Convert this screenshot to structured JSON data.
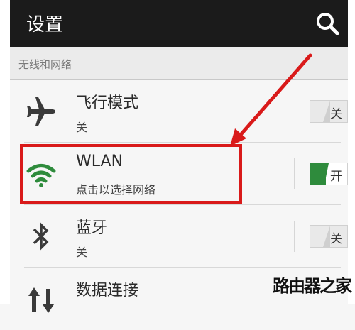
{
  "header": {
    "title": "设置",
    "search_icon": "search-icon"
  },
  "section": {
    "label": "无线和网络"
  },
  "rows": [
    {
      "title": "飞行模式",
      "subtitle": "关",
      "icon": "airplane-icon",
      "toggle": {
        "text": "关",
        "state": "off"
      }
    },
    {
      "title": "WLAN",
      "subtitle": "点击以选择网络",
      "icon": "wifi-icon",
      "toggle": {
        "text": "开",
        "state": "on"
      }
    },
    {
      "title": "蓝牙",
      "subtitle": "关",
      "icon": "bluetooth-icon",
      "toggle": {
        "text": "关",
        "state": "off"
      }
    },
    {
      "title": "数据连接",
      "icon": "data-transfer-icon"
    }
  ],
  "colors": {
    "action_bar": "#1b1b1b",
    "highlight": "#d91a1a",
    "toggle_on": "#2e8b3c",
    "wifi": "#2e8b3c"
  },
  "watermark": "路由器之家"
}
